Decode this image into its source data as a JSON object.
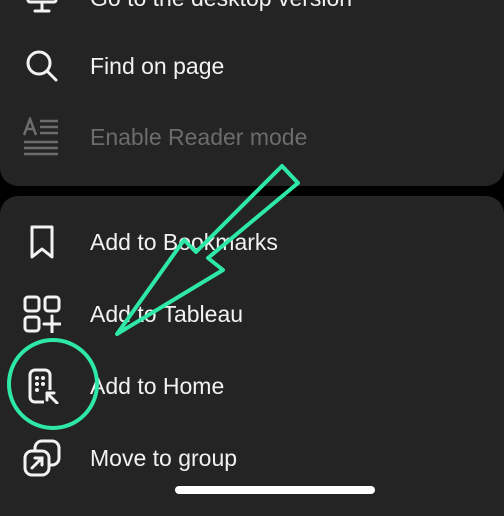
{
  "top_menu": {
    "items": [
      {
        "label": "Go to the desktop version",
        "icon": "desktop-icon",
        "disabled": false
      },
      {
        "label": "Find on page",
        "icon": "search-icon",
        "disabled": false
      },
      {
        "label": "Enable Reader mode",
        "icon": "reader-mode-icon",
        "disabled": true
      }
    ]
  },
  "bottom_menu": {
    "items": [
      {
        "label": "Add to Bookmarks",
        "icon": "bookmark-icon"
      },
      {
        "label": "Add to Tableau",
        "icon": "tableau-icon"
      },
      {
        "label": "Add to Home",
        "icon": "add-to-home-icon"
      },
      {
        "label": "Move to group",
        "icon": "move-to-group-icon"
      }
    ]
  },
  "annotation": {
    "color": "#2ee8a6",
    "arrow": "arrow-annotation",
    "circle": "circle-highlight"
  },
  "colors": {
    "background": "#000000",
    "panel": "#242424",
    "text": "#f2f2f2",
    "disabled_text": "#6c6c6c"
  }
}
